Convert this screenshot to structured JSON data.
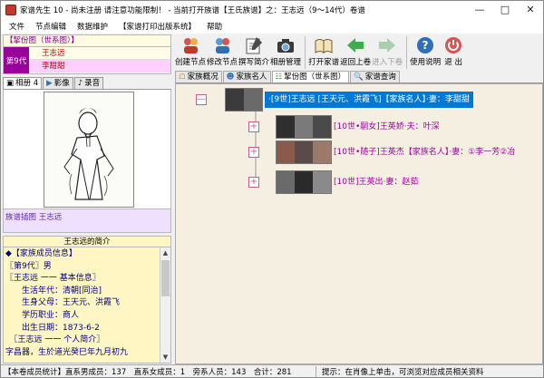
{
  "window": {
    "title": "家谱先生 10 - 尚未注册 请注意功能限制！ - 当前打开族谱【王氏族谱】之：王志远（9～14代）卷谱"
  },
  "menu": [
    "文件",
    "节点编辑",
    "数据维护",
    "【家谱打印出版系统】",
    "帮助"
  ],
  "left": {
    "panel_title": "【挈份图（世系图）】",
    "generation": "第9代",
    "name1": "王志远",
    "name2": "李甜甜",
    "tabs": [
      "相册 4",
      "影像",
      "录音"
    ],
    "photo_caption": "族谱插图 王志远",
    "bio_title": "王志远的简介",
    "bio_lines": [
      "◆【家族成员信息】",
      "〖第9代〗男",
      "〖王志远 一一 基本信息〗",
      "　　生活年代：清朝[同治]",
      "　　生身父母：王天元、洪霞飞",
      "　　学历职业：商人",
      "　　出生日期：1873-6-2",
      "　〖王志远 一一 个人简介〗",
      "字昌器，生於道光癸巳年九月初九"
    ]
  },
  "toolbar": [
    {
      "label": "创建节点",
      "icon": "create-node-icon",
      "color": "#c0392b"
    },
    {
      "label": "修改节点",
      "icon": "edit-node-icon",
      "color": "#2e6fb5"
    },
    {
      "label": "撰写简介",
      "icon": "write-intro-icon",
      "color": "#555555"
    },
    {
      "label": "相册管理",
      "icon": "camera-icon",
      "color": "#333333"
    },
    {
      "label": "打开家谱",
      "icon": "open-book-icon",
      "color": "#7a5a2a"
    },
    {
      "label": "返回上卷",
      "icon": "back-arrow-icon",
      "color": "#2e9e3a"
    },
    {
      "label": "进入下卷",
      "icon": "forward-arrow-icon",
      "color": "#9ab89e"
    },
    {
      "label": "使用说明",
      "icon": "help-icon",
      "color": "#2e6fb5"
    },
    {
      "label": "退 出",
      "icon": "power-icon",
      "color": "#d03030"
    }
  ],
  "main_tabs": [
    "家族概况",
    "家族名人",
    "挈份图（世系图）",
    "家谱查询"
  ],
  "tree": [
    {
      "text": "·[9世]王志远 [王天元、洪霞飞]【家族名人】·妻：李甜甜",
      "selected": true
    },
    {
      "text": "[10世•嗣女]王英娇·夫：叶深",
      "selected": false
    },
    {
      "text": "[10世•随子]王英杰【家族名人】·妻：①李一芳②冶",
      "selected": false
    },
    {
      "text": "[10世]王英出·妻：赵茹",
      "selected": false
    }
  ],
  "status": {
    "left": "【本卷成员统计】直系男成员：137　直系女成员：1　旁系人员：143　合计：281",
    "right": "提示：在肖像上单击，可浏览对应成员相关资料"
  }
}
